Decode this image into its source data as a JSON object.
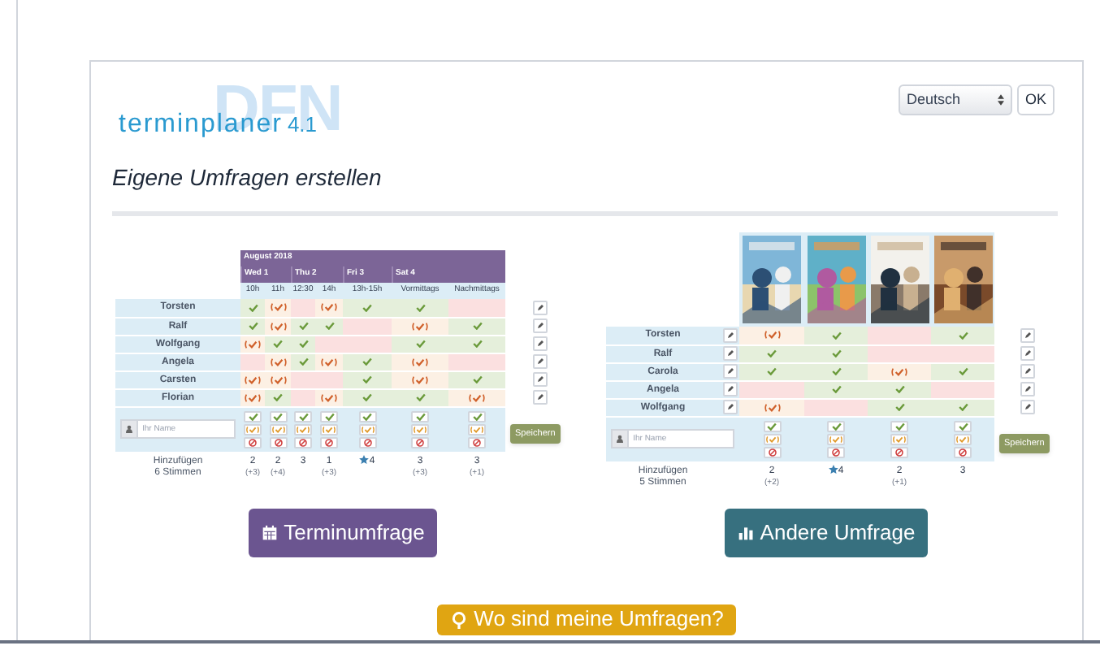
{
  "logo": {
    "text": "terminplaner",
    "version": "4.1",
    "mark": "DFN"
  },
  "language": {
    "value": "Deutsch",
    "button": "OK"
  },
  "heading": "Eigene Umfragen erstellen",
  "date_poll": {
    "month": "August 2018",
    "days": [
      {
        "label": "Wed 1",
        "times": [
          "10h",
          "11h"
        ]
      },
      {
        "label": "Thu 2",
        "times": [
          "12:30",
          "14h"
        ]
      },
      {
        "label": "Fri 3",
        "times": [
          "13h-15h"
        ]
      },
      {
        "label": "Sat 4",
        "times": [
          "Vormittags",
          "Nachmittags"
        ]
      }
    ],
    "rows": [
      {
        "name": "Torsten",
        "votes": [
          {
            "kind": "yes"
          },
          {
            "kind": "maybe"
          },
          {
            "kind": "no"
          },
          {
            "kind": "maybe"
          },
          {
            "kind": "yes"
          },
          {
            "kind": "yes"
          },
          {
            "kind": "no"
          }
        ]
      },
      {
        "name": "Ralf",
        "votes": [
          {
            "kind": "yes"
          },
          {
            "kind": "maybe"
          },
          {
            "kind": "yes"
          },
          {
            "kind": "yes"
          },
          {
            "kind": "no"
          },
          {
            "kind": "maybe"
          },
          {
            "kind": "yes"
          }
        ]
      },
      {
        "name": "Wolfgang",
        "votes": [
          {
            "kind": "maybe"
          },
          {
            "kind": "yes"
          },
          {
            "kind": "yes"
          },
          {
            "kind": "no"
          },
          {
            "kind": "no"
          },
          {
            "kind": "yes"
          },
          {
            "kind": "yes"
          }
        ]
      },
      {
        "name": "Angela",
        "votes": [
          {
            "kind": "no"
          },
          {
            "kind": "maybe"
          },
          {
            "kind": "yes"
          },
          {
            "kind": "maybe"
          },
          {
            "kind": "yes"
          },
          {
            "kind": "maybe"
          },
          {
            "kind": "no"
          }
        ]
      },
      {
        "name": "Carsten",
        "votes": [
          {
            "kind": "maybe"
          },
          {
            "kind": "maybe"
          },
          {
            "kind": "no"
          },
          {
            "kind": "no"
          },
          {
            "kind": "yes"
          },
          {
            "kind": "maybe"
          },
          {
            "kind": "yes"
          }
        ]
      },
      {
        "name": "Florian",
        "votes": [
          {
            "kind": "maybe"
          },
          {
            "kind": "yes"
          },
          {
            "kind": "no"
          },
          {
            "kind": "maybe"
          },
          {
            "kind": "yes"
          },
          {
            "kind": "yes"
          },
          {
            "kind": "maybe"
          }
        ]
      }
    ],
    "name_placeholder": "Ihr Name",
    "save": "Speichern",
    "add_label": "Hinzufügen",
    "vote_count": "6 Stimmen",
    "totals": [
      {
        "count": "2",
        "extra": "(+3)",
        "best": false
      },
      {
        "count": "2",
        "extra": "(+4)",
        "best": false
      },
      {
        "count": "3",
        "best": false
      },
      {
        "count": "1",
        "extra": "(+3)",
        "best": false
      },
      {
        "count": "4",
        "best": true
      },
      {
        "count": "3",
        "extra": "(+3)",
        "best": false
      },
      {
        "count": "3",
        "extra": "(+1)",
        "best": false
      }
    ]
  },
  "other_poll": {
    "rows": [
      {
        "name": "Torsten",
        "votes": [
          {
            "kind": "maybe"
          },
          {
            "kind": "yes"
          },
          {
            "kind": "no"
          },
          {
            "kind": "yes"
          }
        ]
      },
      {
        "name": "Ralf",
        "votes": [
          {
            "kind": "yes"
          },
          {
            "kind": "yes"
          },
          {
            "kind": "no"
          },
          {
            "kind": "no"
          }
        ]
      },
      {
        "name": "Carola",
        "votes": [
          {
            "kind": "yes"
          },
          {
            "kind": "yes"
          },
          {
            "kind": "maybe"
          },
          {
            "kind": "yes"
          }
        ]
      },
      {
        "name": "Angela",
        "votes": [
          {
            "kind": "no"
          },
          {
            "kind": "yes"
          },
          {
            "kind": "yes"
          },
          {
            "kind": "no"
          }
        ]
      },
      {
        "name": "Wolfgang",
        "votes": [
          {
            "kind": "maybe"
          },
          {
            "kind": "no"
          },
          {
            "kind": "yes"
          },
          {
            "kind": "yes"
          }
        ]
      }
    ],
    "name_placeholder": "Ihr Name",
    "save": "Speichern",
    "add_label": "Hinzufügen",
    "vote_count": "5 Stimmen",
    "totals": [
      {
        "count": "2",
        "extra": "(+2)",
        "best": false
      },
      {
        "count": "4",
        "best": true
      },
      {
        "count": "2",
        "extra": "(+1)",
        "best": false
      },
      {
        "count": "3",
        "best": false
      }
    ]
  },
  "buttons": [
    {
      "label": "Terminumfrage",
      "kind": "calendar"
    },
    {
      "label": "Andere Umfrage",
      "kind": "chart"
    },
    {
      "label": "Wo sind meine Umfragen?",
      "kind": "search"
    }
  ]
}
